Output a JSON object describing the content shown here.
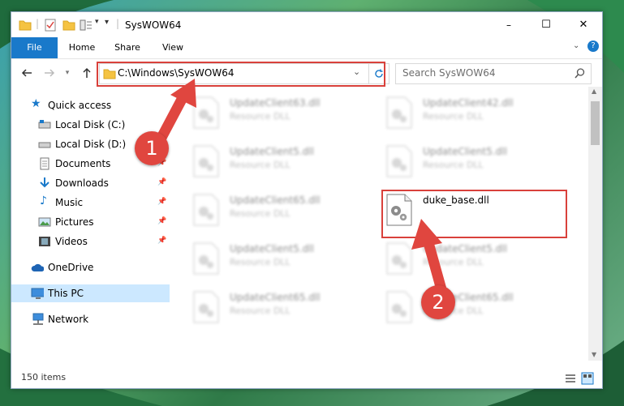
{
  "window": {
    "title": "SysWOW64",
    "controls": {
      "minimize": "–",
      "maximize": "☐",
      "close": "✕"
    }
  },
  "ribbon": {
    "tabs": [
      "File",
      "Home",
      "Share",
      "View"
    ]
  },
  "address_bar": {
    "path": "C:\\Windows\\SysWOW64"
  },
  "search": {
    "placeholder": "Search SysWOW64"
  },
  "sidebar": {
    "quick_access": "Quick access",
    "items": [
      {
        "label": "Local Disk (C:)",
        "icon": "drive-icon",
        "pinned": false
      },
      {
        "label": "Local Disk (D:)",
        "icon": "drive-icon",
        "pinned": false
      },
      {
        "label": "Documents",
        "icon": "documents-icon",
        "pinned": true
      },
      {
        "label": "Downloads",
        "icon": "download-icon",
        "pinned": true
      },
      {
        "label": "Music",
        "icon": "music-icon",
        "pinned": true
      },
      {
        "label": "Pictures",
        "icon": "pictures-icon",
        "pinned": true
      },
      {
        "label": "Videos",
        "icon": "videos-icon",
        "pinned": true
      }
    ],
    "onedrive": "OneDrive",
    "this_pc": "This PC",
    "network": "Network"
  },
  "files": [
    {
      "name": "UpdateClient63.dll",
      "type": "Resource DLL",
      "blurred": true
    },
    {
      "name": "UpdateClient42.dll",
      "type": "Resource DLL",
      "blurred": true
    },
    {
      "name": "UpdateClient5.dll",
      "type": "Resource DLL",
      "blurred": true
    },
    {
      "name": "UpdateClient5.dll",
      "type": "Resource DLL",
      "blurred": true
    },
    {
      "name": "UpdateClient65.dll",
      "type": "Resource DLL",
      "blurred": true
    },
    {
      "name": "duke_base.dll",
      "type": "",
      "blurred": false
    },
    {
      "name": "UpdateClient5.dll",
      "type": "Resource DLL",
      "blurred": true
    },
    {
      "name": "UpdateClient5.dll",
      "type": "Resource DLL",
      "blurred": true
    },
    {
      "name": "UpdateClient65.dll",
      "type": "Resource DLL",
      "blurred": true
    },
    {
      "name": "UpdateClient65.dll",
      "type": "Resource DLL",
      "blurred": true
    }
  ],
  "status": {
    "item_count": "150 items"
  },
  "annotations": {
    "step1": "1",
    "step2": "2"
  },
  "colors": {
    "accent": "#1979ca",
    "annotation": "#d9413b",
    "selection": "#cce8ff"
  }
}
